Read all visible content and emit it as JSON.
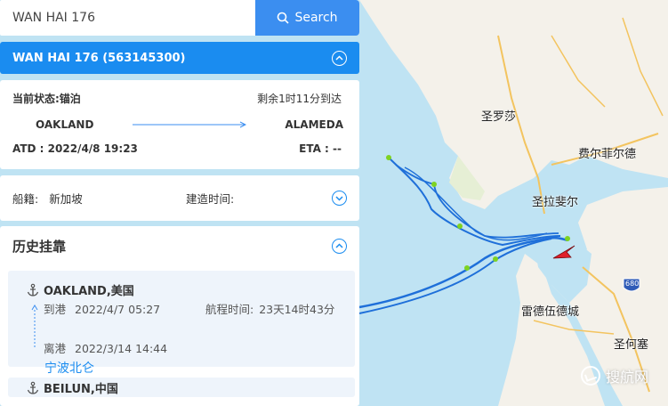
{
  "search": {
    "value": "WAN HAI 176",
    "button_label": "Search"
  },
  "vessel": {
    "title": "WAN HAI 176 (563145300)"
  },
  "status": {
    "current_status": "当前状态:锚泊",
    "eta_remaining": "剩余1时11分到达",
    "origin": "OAKLAND",
    "destination": "ALAMEDA",
    "atd": "ATD : 2022/4/8 19:23",
    "eta": "ETA : --"
  },
  "info": {
    "flag_label": "船籍:",
    "flag_value": "新加坡",
    "build_label": "建造时间:"
  },
  "history": {
    "title": "历史挂靠",
    "entries": [
      {
        "port": "OAKLAND,美国",
        "arrival_label": "到港",
        "arrival": "2022/4/7 05:27",
        "voyage_label": "航程时间:",
        "voyage": "23天14时43分",
        "departure_label": "离港",
        "departure": "2022/3/14 14:44"
      }
    ],
    "next_port_link": "宁波北仑",
    "second_port": "BEILUN,中国"
  },
  "map": {
    "cities": [
      "圣罗莎",
      "费尔菲尔德",
      "圣拉斐尔",
      "雷德伍德城",
      "圣何塞"
    ],
    "highway_shield": "680",
    "watermark": "搜航网"
  },
  "colors": {
    "accent": "#1a8cf0",
    "search_button": "#3b8ef0",
    "track": "#1e6fd9",
    "vessel_marker": "#e0202a",
    "water": "#bfe3f3"
  }
}
